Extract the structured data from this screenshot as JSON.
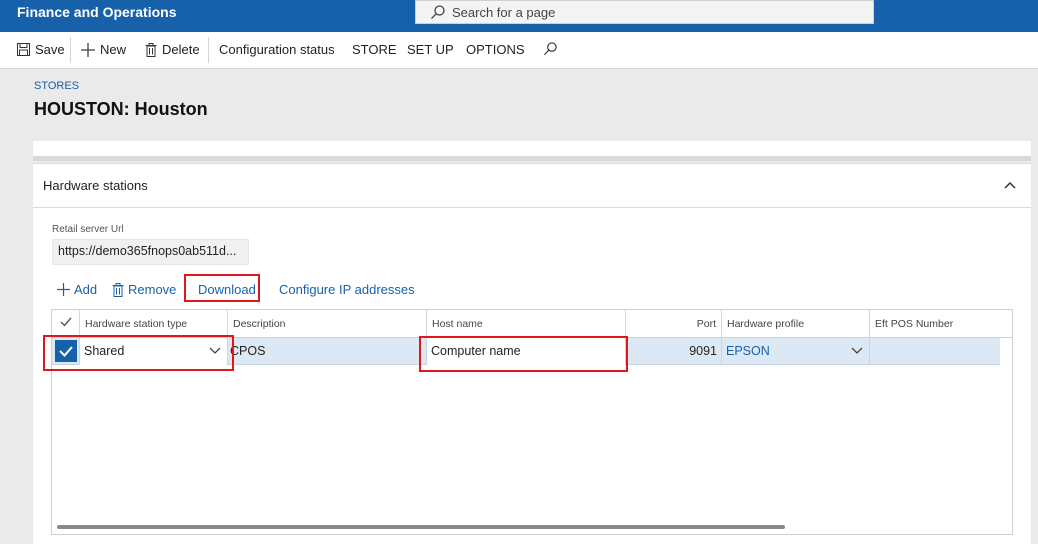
{
  "app": {
    "title": "Finance and Operations"
  },
  "search": {
    "placeholder": "Search for a page"
  },
  "toolbar": {
    "save": "Save",
    "new": "New",
    "delete": "Delete",
    "config_status": "Configuration status",
    "store": "STORE",
    "setup": "SET UP",
    "options": "OPTIONS"
  },
  "header": {
    "breadcrumb": "STORES",
    "title": "HOUSTON: Houston"
  },
  "hardware": {
    "section_title": "Hardware stations",
    "retail_url_label": "Retail server Url",
    "retail_url_value": "https://demo365fnops0ab511d...",
    "actions": {
      "add": "Add",
      "remove": "Remove",
      "download": "Download",
      "configure_ip": "Configure IP addresses"
    },
    "columns": [
      "Hardware station type",
      "Description",
      "Host name",
      "Port",
      "Hardware profile",
      "Eft POS Number"
    ],
    "row": {
      "type": "Shared",
      "description": "CPOS",
      "host": "Computer name",
      "port": "9091",
      "profile": "EPSON",
      "eft": ""
    }
  },
  "colors": {
    "brand": "#1761ab",
    "highlight": "#e0161b",
    "selected_row": "#dde8f5"
  },
  "icons": [
    "search-icon",
    "save-icon",
    "plus-icon",
    "trash-icon",
    "chevron-up-icon",
    "chevron-down-icon",
    "checkmark-icon"
  ]
}
